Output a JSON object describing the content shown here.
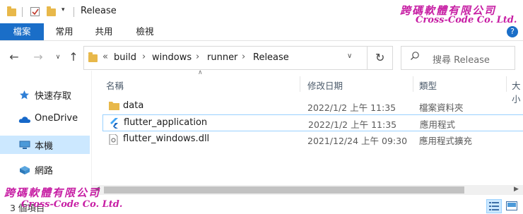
{
  "window": {
    "title": "Release"
  },
  "ribbon": {
    "tabs": [
      "檔案",
      "常用",
      "共用",
      "檢視"
    ]
  },
  "address": {
    "crumbs": [
      "build",
      "windows",
      "runner",
      "Release"
    ],
    "overflow": "«"
  },
  "search": {
    "placeholder": "搜尋 Release"
  },
  "columns": {
    "name": "名稱",
    "modified": "修改日期",
    "type": "類型",
    "size": "大小"
  },
  "nav": {
    "items": [
      {
        "label": "快速存取"
      },
      {
        "label": "OneDrive"
      },
      {
        "label": "本機"
      },
      {
        "label": "網路"
      }
    ]
  },
  "files": [
    {
      "name": "data",
      "modified": "2022/1/2 上午 11:35",
      "type": "檔案資料夾"
    },
    {
      "name": "flutter_application",
      "modified": "2022/1/2 上午 11:35",
      "type": "應用程式"
    },
    {
      "name": "flutter_windows.dll",
      "modified": "2021/12/24 上午 09:30",
      "type": "應用程式擴充"
    }
  ],
  "status": {
    "count": "3 個項目"
  },
  "watermark": {
    "company_cn": "跨碼軟體有限公司",
    "company_en": "Cross-Code Co. Ltd."
  },
  "colors": {
    "accent": "#1a6ec8",
    "watermark": "#c71fa4",
    "selection": "#99d1ff",
    "folder": "#e8b84a"
  }
}
